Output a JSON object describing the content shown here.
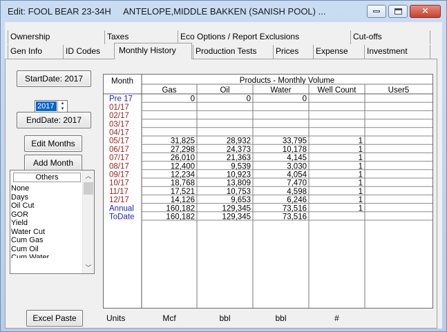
{
  "window": {
    "title": "Edit: FOOL BEAR 23-34H     ANTELOPE,MIDDLE BAKKEN (SANISH POOL) ...",
    "close_glyph": "✕"
  },
  "tabs_row1": [
    "Ownership",
    "Taxes",
    "Eco Options / Report Exclusions",
    "Cut-offs"
  ],
  "tabs_row2": [
    "Gen Info",
    "ID Codes",
    "Monthly History",
    "Production Tests",
    "Prices",
    "Expense",
    "Investment"
  ],
  "active_tab": "Monthly History",
  "controls": {
    "start_date_button": "StartDate: 2017",
    "year_value": "2017",
    "end_date_button": "EndDate: 2017",
    "edit_months_button": "Edit Months",
    "add_month_button": "Add Month",
    "excel_paste_button": "Excel Paste"
  },
  "others": {
    "header": "Others",
    "items": [
      "None",
      "Days",
      "Oil Cut",
      "GOR",
      "Yield",
      "Water Cut",
      "Cum Gas",
      "Cum Oil",
      "Cum Water"
    ]
  },
  "grid": {
    "month_header": "Month",
    "group_header": "Products - Monthly Volume",
    "columns": [
      "Gas",
      "Oil",
      "Water",
      "Well Count",
      "User5"
    ],
    "rows": [
      {
        "month": "Pre 17",
        "gas": "0",
        "oil": "0",
        "water": "0",
        "wells": "",
        "user5": "",
        "blue": true
      },
      {
        "month": "01/17",
        "gas": "",
        "oil": "",
        "water": "",
        "wells": "",
        "user5": ""
      },
      {
        "month": "02/17",
        "gas": "",
        "oil": "",
        "water": "",
        "wells": "",
        "user5": ""
      },
      {
        "month": "03/17",
        "gas": "",
        "oil": "",
        "water": "",
        "wells": "",
        "user5": ""
      },
      {
        "month": "04/17",
        "gas": "",
        "oil": "",
        "water": "",
        "wells": "",
        "user5": ""
      },
      {
        "month": "05/17",
        "gas": "31,825",
        "oil": "28,932",
        "water": "33,795",
        "wells": "1",
        "user5": ""
      },
      {
        "month": "06/17",
        "gas": "27,298",
        "oil": "24,373",
        "water": "10,178",
        "wells": "1",
        "user5": ""
      },
      {
        "month": "07/17",
        "gas": "26,010",
        "oil": "21,363",
        "water": "4,145",
        "wells": "1",
        "user5": ""
      },
      {
        "month": "08/17",
        "gas": "12,400",
        "oil": "9,539",
        "water": "3,030",
        "wells": "1",
        "user5": ""
      },
      {
        "month": "09/17",
        "gas": "12,234",
        "oil": "10,923",
        "water": "4,054",
        "wells": "1",
        "user5": ""
      },
      {
        "month": "10/17",
        "gas": "18,768",
        "oil": "13,809",
        "water": "7,470",
        "wells": "1",
        "user5": ""
      },
      {
        "month": "11/17",
        "gas": "17,521",
        "oil": "10,753",
        "water": "4,598",
        "wells": "1",
        "user5": ""
      },
      {
        "month": "12/17",
        "gas": "14,126",
        "oil": "9,653",
        "water": "6,246",
        "wells": "1",
        "user5": ""
      },
      {
        "month": "Annual",
        "gas": "160,182",
        "oil": "129,345",
        "water": "73,516",
        "wells": "1",
        "user5": "",
        "blue": true
      },
      {
        "month": "ToDate",
        "gas": "160,182",
        "oil": "129,345",
        "water": "73,516",
        "wells": "",
        "user5": "",
        "blue": true
      }
    ]
  },
  "units": {
    "label": "Units",
    "values": [
      "Mcf",
      "bbl",
      "bbl",
      "#",
      ""
    ]
  },
  "colors": {
    "month_red": "#9b1c1c",
    "month_blue": "#1f1fb0",
    "selection": "#0a66c8"
  }
}
